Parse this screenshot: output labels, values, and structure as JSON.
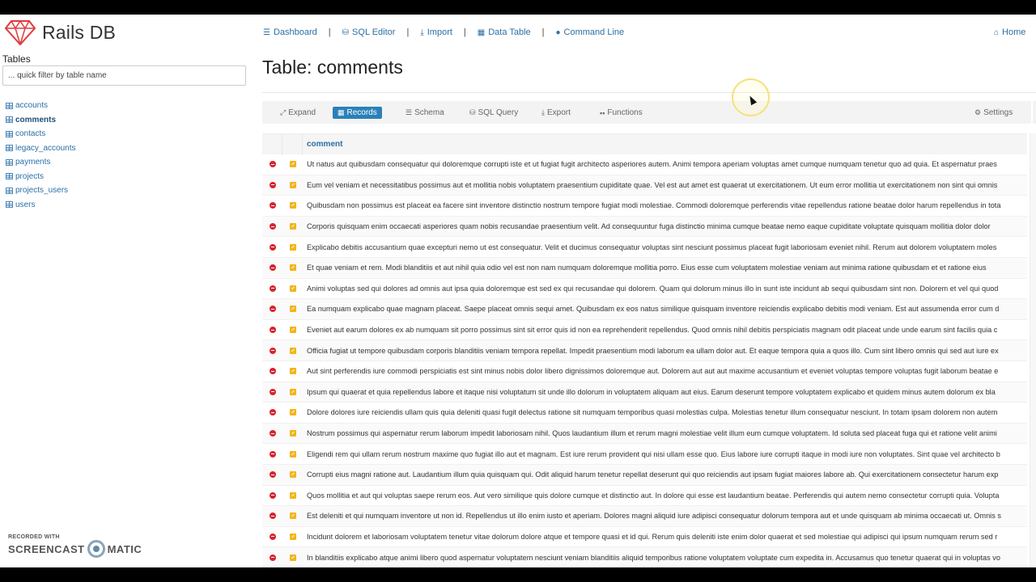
{
  "app": {
    "name": "Rails DB"
  },
  "sidebar": {
    "title": "Tables",
    "filter_placeholder": "... quick filter by table name",
    "tables": [
      {
        "label": "accounts",
        "active": false
      },
      {
        "label": "comments",
        "active": true
      },
      {
        "label": "contacts",
        "active": false
      },
      {
        "label": "legacy_accounts",
        "active": false
      },
      {
        "label": "payments",
        "active": false
      },
      {
        "label": "projects",
        "active": false
      },
      {
        "label": "projects_users",
        "active": false
      },
      {
        "label": "users",
        "active": false
      }
    ]
  },
  "nav": {
    "items": [
      {
        "label": "Dashboard",
        "icon": "list-icon"
      },
      {
        "label": "SQL Editor",
        "icon": "database-icon"
      },
      {
        "label": "Import",
        "icon": "download-icon"
      },
      {
        "label": "Data Table",
        "icon": "table-icon"
      },
      {
        "label": "Command Line",
        "icon": "circle-icon"
      }
    ],
    "separator": "|",
    "home": "Home"
  },
  "page": {
    "title": "Table: comments"
  },
  "toolbar": {
    "buttons": [
      {
        "label": "Expand",
        "icon": "expand-icon"
      },
      {
        "label": "Records",
        "icon": "table-icon",
        "active": true
      },
      {
        "label": "Schema",
        "icon": "list-icon"
      },
      {
        "label": "SQL Query",
        "icon": "database-icon"
      },
      {
        "label": "Export",
        "icon": "download-icon"
      },
      {
        "label": "Functions",
        "icon": "grid-icon"
      }
    ],
    "settings": "Settings"
  },
  "table": {
    "column": "comment",
    "rows": [
      "Ut natus aut quibusdam consequatur qui doloremque corrupti iste et ut fugiat fugit architecto asperiores autem. Animi tempora aperiam voluptas amet cumque numquam tenetur quo ad quia. Et aspernatur praes",
      "Eum vel veniam et necessitatibus possimus aut et mollitia nobis voluptatem praesentium cupiditate quae. Vel est aut amet est quaerat ut exercitationem. Ut eum error mollitia ut exercitationem non sint qui omnis",
      "Quibusdam non possimus est placeat ea facere sint inventore distinctio nostrum tempore fugiat modi molestiae. Commodi doloremque perferendis vitae repellendus ratione beatae dolor harum repellendus in tota",
      "Corporis quisquam enim occaecati asperiores quam nobis recusandae praesentium velit. Ad consequuntur fuga distinctio minima cumque beatae nemo eaque cupiditate voluptate quisquam mollitia dolor dolor",
      "Explicabo debitis accusantium quae excepturi nemo ut est consequatur. Velit et ducimus consequatur voluptas sint nesciunt possimus placeat fugit laboriosam eveniet nihil. Rerum aut dolorem voluptatem moles",
      "Et quae veniam et rem. Modi blanditiis et aut nihil quia odio vel est non nam numquam doloremque mollitia porro. Eius esse cum voluptatem molestiae veniam aut minima ratione quibusdam et et ratione eius",
      "Animi voluptas sed qui dolores ad omnis aut ipsa quia doloremque est sed ex qui recusandae qui dolorem. Quam qui dolorum minus illo in sunt iste incidunt ab sequi quibusdam sint non. Dolorem et vel qui quod",
      "Ea numquam explicabo quae magnam placeat. Saepe placeat omnis sequi amet. Quibusdam ex eos natus similique quisquam inventore reiciendis explicabo debitis modi veniam. Est aut assumenda error cum d",
      "Eveniet aut earum dolores ex ab numquam sit porro possimus sint sit error quis id non ea reprehenderit repellendus. Quod omnis nihil debitis perspiciatis magnam odit placeat unde unde earum sint facilis quia c",
      "Officia fugiat ut tempore quibusdam corporis blanditiis veniam tempora repellat. Impedit praesentium modi laborum ea ullam dolor aut. Et eaque tempora quia a quos illo. Cum sint libero omnis qui sed aut iure ex",
      "Aut sint perferendis iure commodi perspiciatis est sint minus nobis dolor libero dignissimos doloremque aut. Dolorem aut aut aut maxime accusantium et eveniet voluptas tempore voluptas fugit laborum beatae e",
      "Ipsum qui quaerat et quia repellendus labore et itaque nisi voluptatum sit unde illo dolorum in voluptatem aliquam aut eius. Earum deserunt tempore voluptatem explicabo et quidem minus autem dolorum ex bla",
      "Dolore dolores iure reiciendis ullam quis quia deleniti quasi fugit delectus ratione sit numquam temporibus quasi molestias culpa. Molestias tenetur illum consequatur nesciunt. In totam ipsam dolorem non autem",
      "Nostrum possimus qui aspernatur rerum laborum impedit laboriosam nihil. Quos laudantium illum et rerum magni molestiae velit illum eum cumque voluptatem. Id soluta sed placeat fuga qui et ratione velit animi",
      "Eligendi rem qui ullam rerum nostrum maxime quo fugiat illo aut et magnam. Est iure rerum provident qui nisi ullam esse quo. Eius labore iure corrupti itaque in modi iure non voluptates. Sint quae vel architecto b",
      "Corrupti eius magni ratione aut. Laudantium illum quia quisquam qui. Odit aliquid harum tenetur repellat deserunt qui quo reiciendis aut ipsam fugiat maiores labore ab. Qui exercitationem consectetur harum exp",
      "Quos mollitia et aut qui voluptas saepe rerum eos. Aut vero similique quis dolore cumque et distinctio aut. In dolore qui esse est laudantium beatae. Perferendis qui autem nemo consectetur corrupti quia. Volupta",
      "Est deleniti et qui numquam inventore ut non id. Repellendus ut illo enim iusto et aperiam. Dolores magni aliquid iure adipisci consequatur dolorum tempora aut et unde quisquam ab minima occaecati ut. Omnis s",
      "Incidunt dolorem et laboriosam voluptatem tenetur vitae dolorum dolore atque et tempore quasi et id qui. Rerum quis deleniti iste enim dolor quaerat et sed molestiae qui adipisci qui ipsum numquam rerum sed r",
      "In blanditiis explicabo atque animi libero quod aspernatur voluptatem nesciunt veniam blanditiis aliquid temporibus ratione voluptatem voluptate cum expedita in. Accusamus quo tenetur quaerat qui in voluptas vo"
    ]
  },
  "watermark": {
    "line1": "RECORDED WITH",
    "line2_left": "SCREENCAST",
    "line2_right": "MATIC"
  },
  "colors": {
    "accent": "#2a81b8",
    "link": "#2a6fa5",
    "delete": "#d9232d",
    "edit": "#f2b51b",
    "logo": "#e03a3e"
  }
}
